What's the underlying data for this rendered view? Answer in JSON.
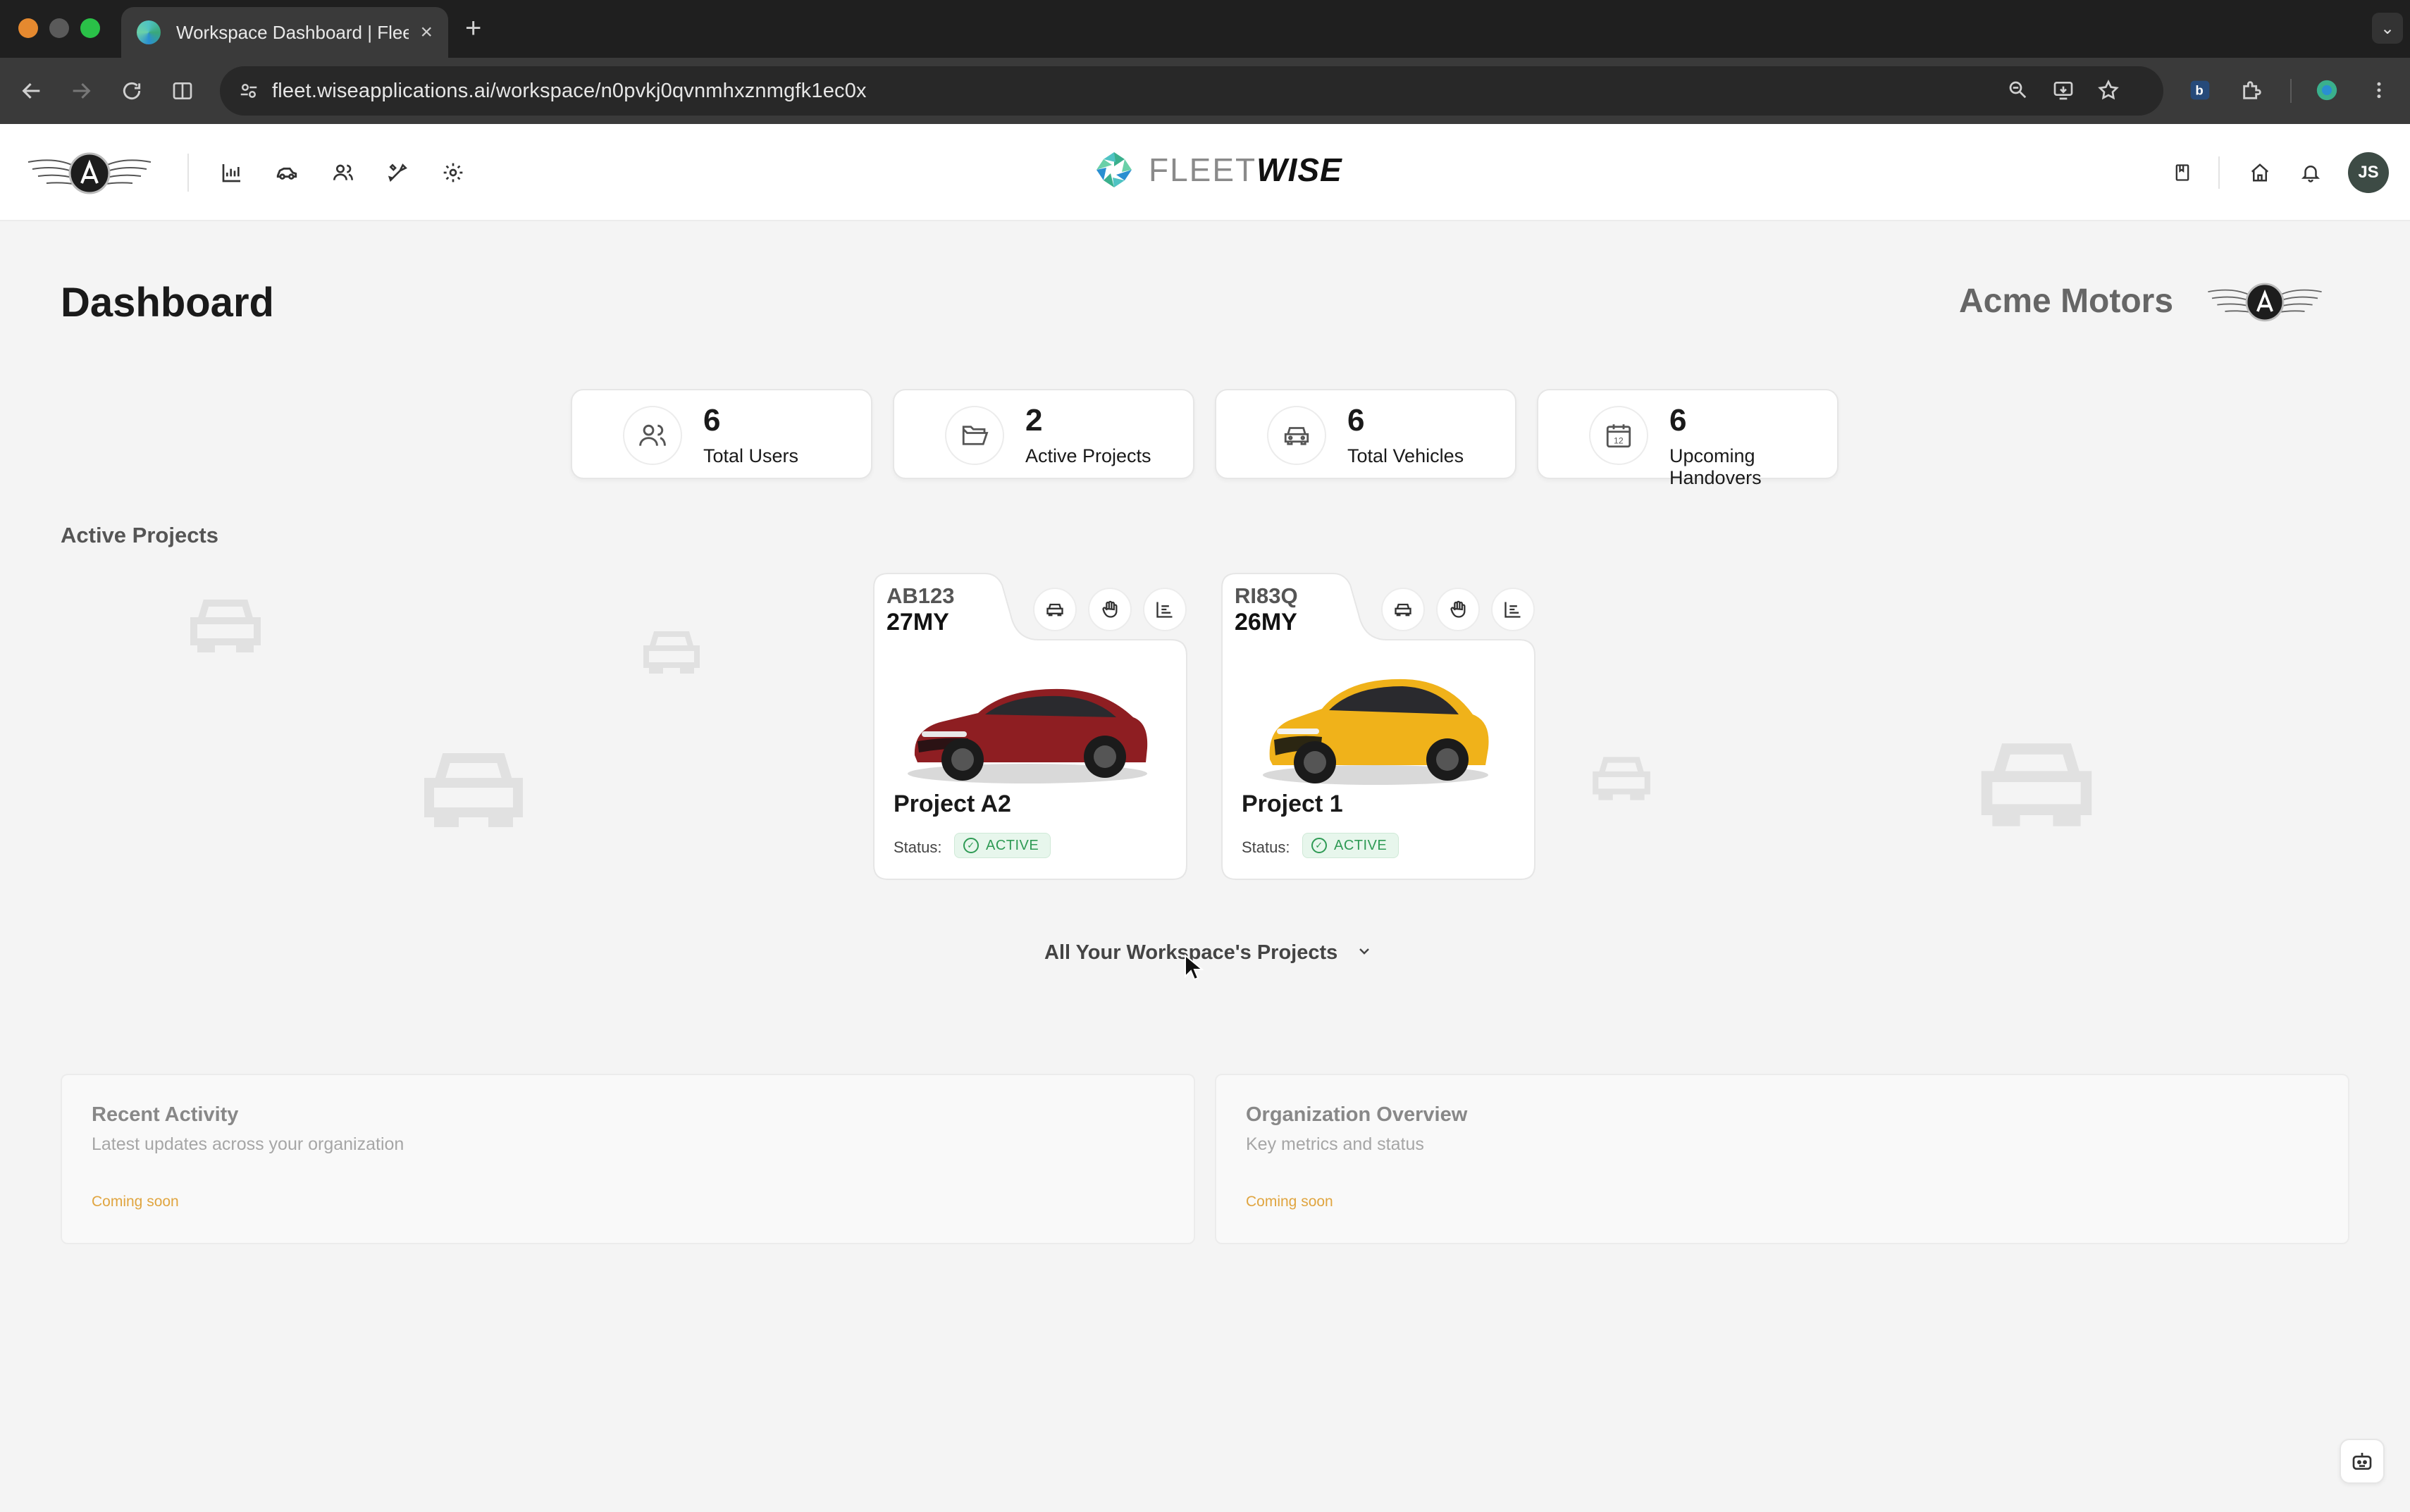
{
  "browser": {
    "tab_title": "Workspace Dashboard | FleetWise",
    "tab_close": "×",
    "new_tab": "+",
    "url": "fleet.wiseapplications.ai/workspace/n0pvkj0qvnmhxznmgfk1ec0x"
  },
  "header": {
    "brand_fleet": "FLEET",
    "brand_wise": "WISE",
    "avatar_initials": "JS",
    "nav_icons": [
      "analytics-icon",
      "vehicle-icon",
      "users-icon",
      "tools-icon",
      "settings-icon"
    ],
    "right_icons": [
      "bookmark-icon",
      "home-icon",
      "bell-icon"
    ]
  },
  "page": {
    "title": "Dashboard",
    "org_name": "Acme Motors"
  },
  "stats": [
    {
      "value": "6",
      "label": "Total Users",
      "icon": "users-icon"
    },
    {
      "value": "2",
      "label": "Active Projects",
      "icon": "folder-icon"
    },
    {
      "value": "6",
      "label": "Total Vehicles",
      "icon": "car-icon"
    },
    {
      "value": "6",
      "label": "Upcoming Handovers",
      "icon": "calendar-icon"
    }
  ],
  "active_projects": {
    "section_title": "Active Projects",
    "status_label": "Status:",
    "projects": [
      {
        "code": "AB123",
        "model_year": "27MY",
        "name": "Project A2",
        "status": "ACTIVE",
        "car_color": "#8e1e22"
      },
      {
        "code": "RI83Q",
        "model_year": "26MY",
        "name": "Project 1",
        "status": "ACTIVE",
        "car_color": "#f0b21a"
      }
    ],
    "all_projects_label": "All Your Workspace's Projects"
  },
  "panels": [
    {
      "title": "Recent Activity",
      "subtitle": "Latest updates across your organization",
      "status": "Coming soon"
    },
    {
      "title": "Organization Overview",
      "subtitle": "Key metrics and status",
      "status": "Coming soon"
    }
  ],
  "colors": {
    "accent_green": "#2e9a54",
    "coming_soon": "#e0a540",
    "avatar_bg": "#3d4b45"
  }
}
